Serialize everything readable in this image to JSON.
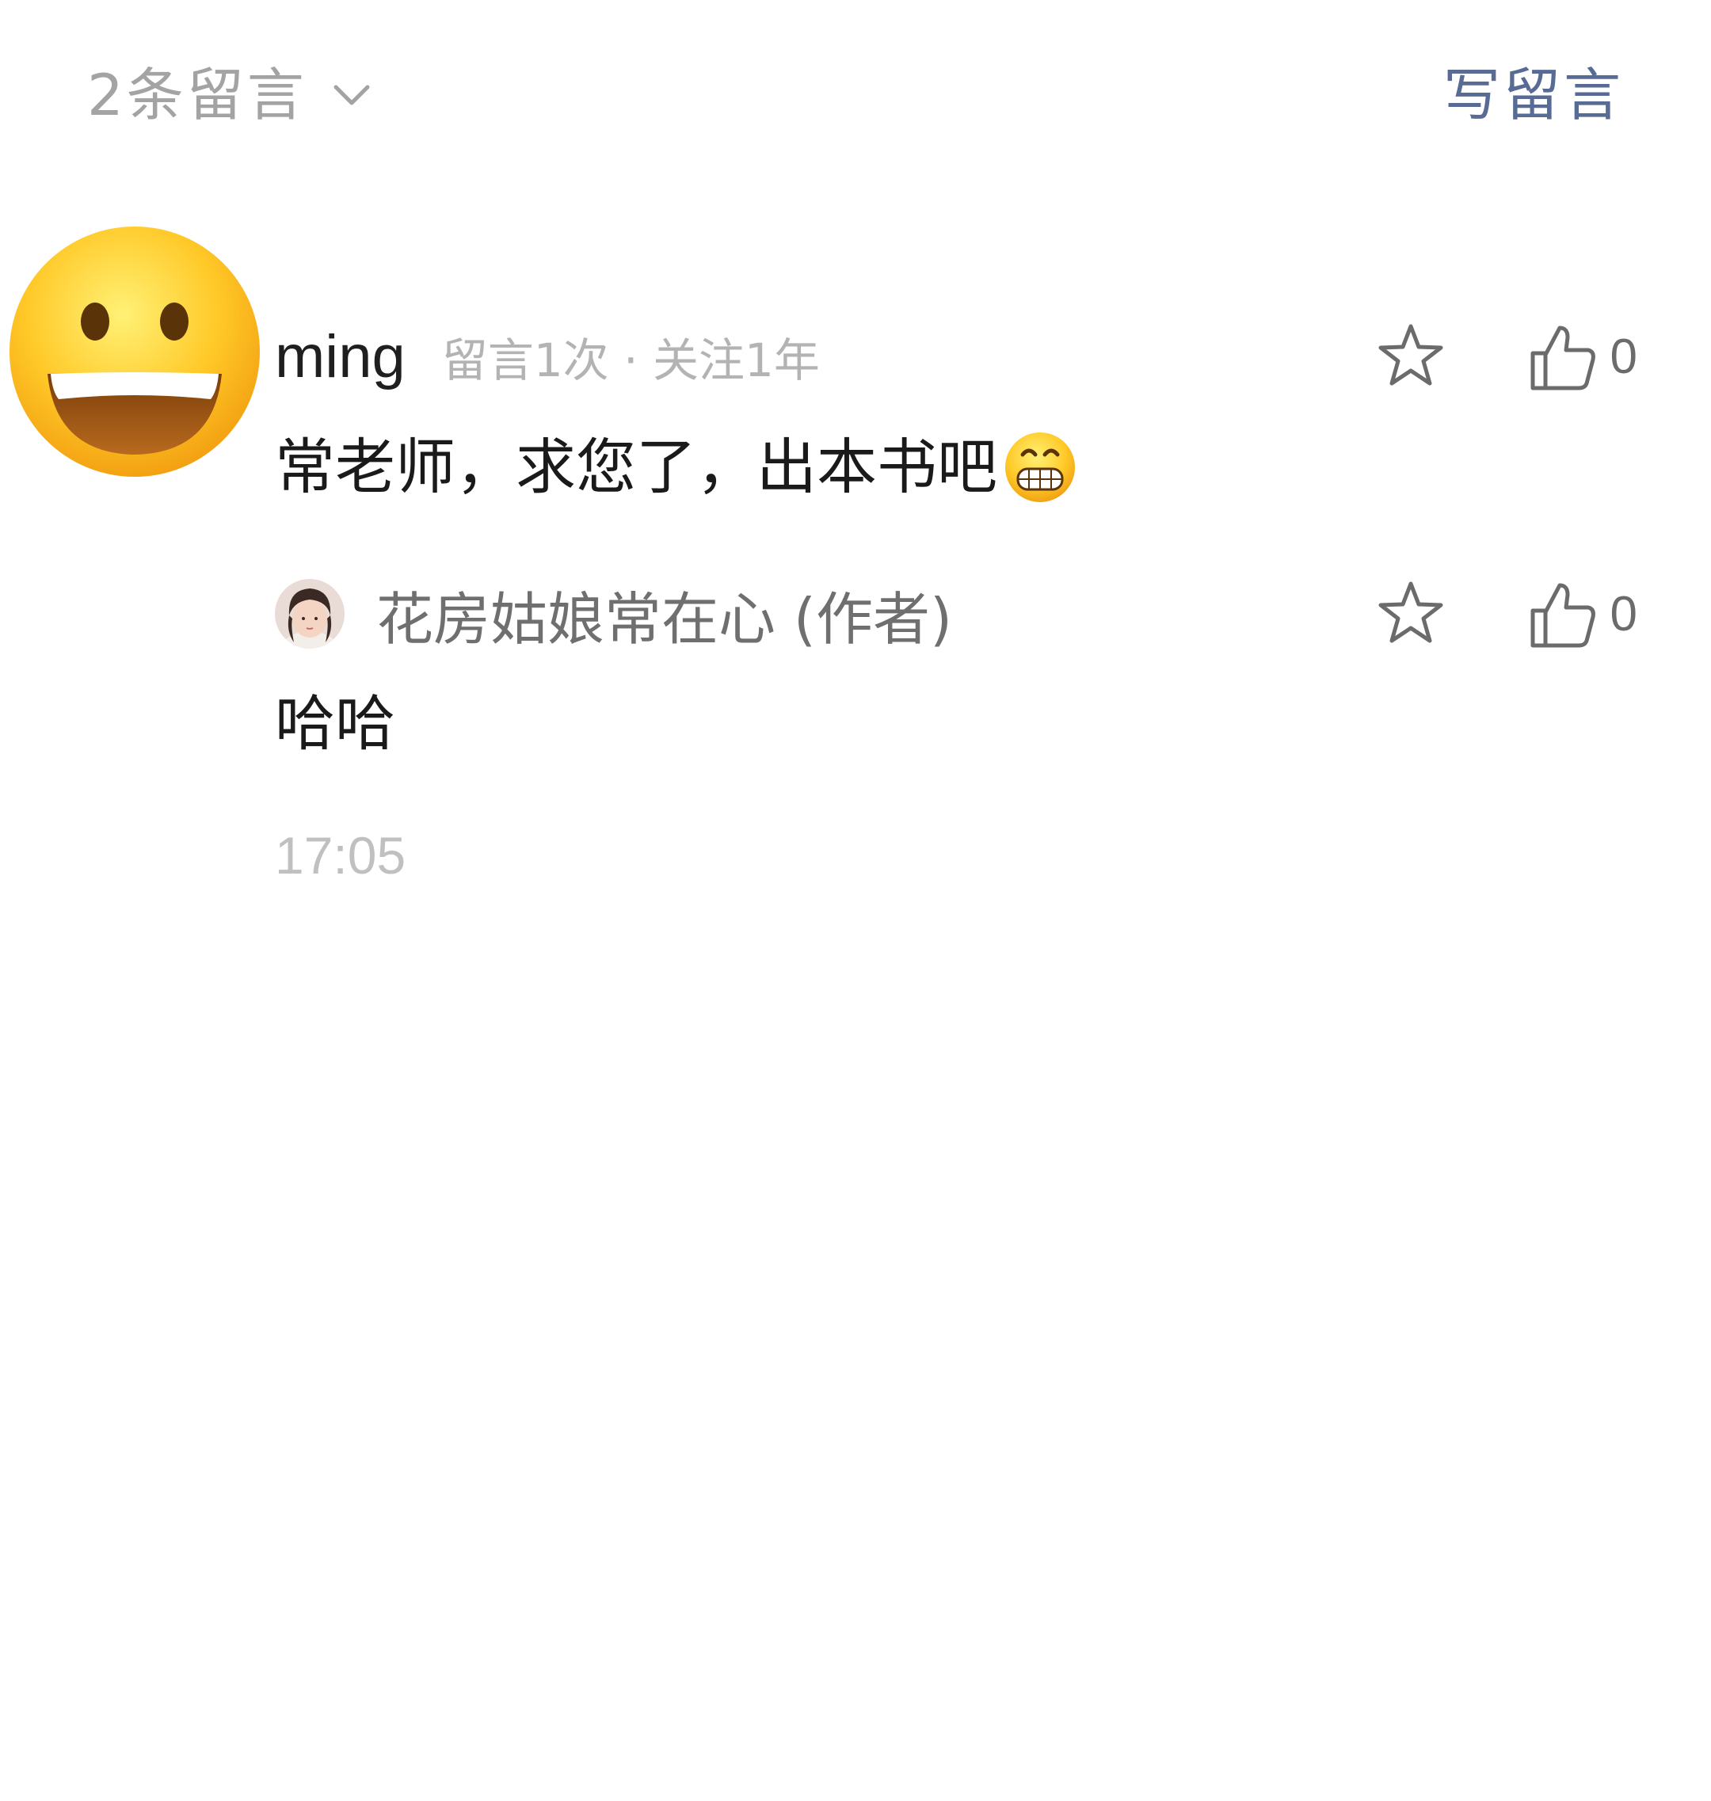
{
  "header": {
    "comment_count_label": "2条留言",
    "write_comment_label": "写留言"
  },
  "comment": {
    "username": "ming",
    "meta": "留言1次 · 关注1年",
    "text": "常老师，求您了，出本书吧",
    "like_count": "0",
    "avatar_icon": "grinning-face-emoji",
    "trailing_emoji": "grinning-teeth-emoji",
    "reply": {
      "author": "花房姑娘常在心 (作者)",
      "text": "哈哈",
      "like_count": "0"
    },
    "timestamp": "17:05"
  },
  "colors": {
    "link_blue": "#576b95",
    "gray_text": "#a3a3a3"
  }
}
